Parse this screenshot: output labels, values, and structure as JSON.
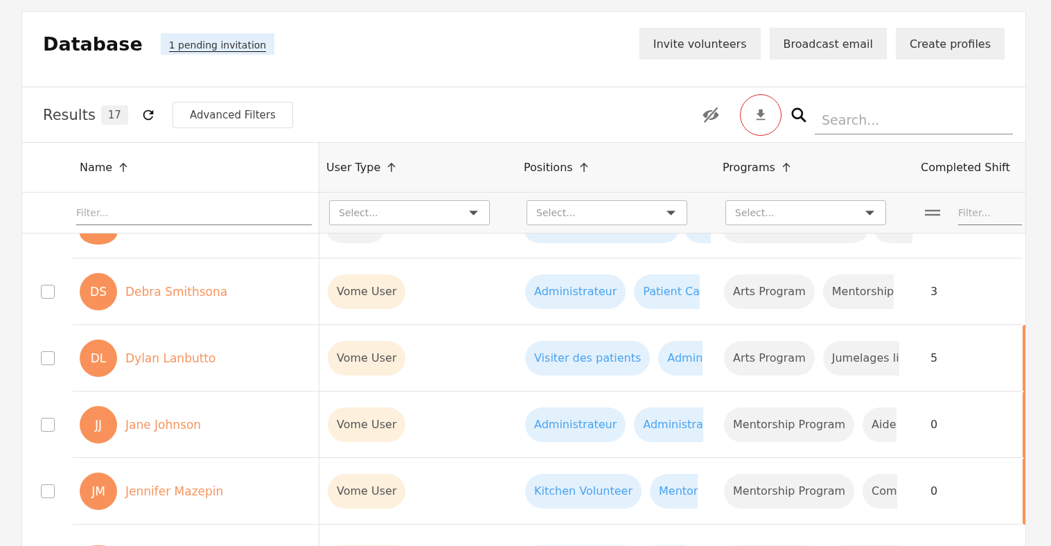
{
  "header": {
    "title": "Database",
    "pending_link": "1 pending invitation",
    "buttons": [
      "Invite volunteers",
      "Broadcast email",
      "Create profiles"
    ]
  },
  "toolbar": {
    "results_label": "Results",
    "results_count": "17",
    "advanced_filters": "Advanced Filters",
    "search_placeholder": "Search..."
  },
  "columns": [
    {
      "label": "Name",
      "sort_icon": true
    },
    {
      "label": "User Type",
      "sort_icon": true
    },
    {
      "label": "Positions",
      "sort_icon": true
    },
    {
      "label": "Programs",
      "sort_icon": true
    },
    {
      "label": "Completed Shift",
      "sort_icon": false
    }
  ],
  "filters": [
    {
      "kind": "text",
      "placeholder": "Filter..."
    },
    {
      "kind": "select",
      "placeholder": "Select..."
    },
    {
      "kind": "select",
      "placeholder": "Select..."
    },
    {
      "kind": "select",
      "placeholder": "Select..."
    },
    {
      "kind": "number",
      "placeholder": "Filter..."
    }
  ],
  "rows": [
    {
      "checked": false,
      "initials": "DS",
      "name": "Debra Smithsona",
      "user_type": "Vome User",
      "positions": [
        "Administrateur",
        "Patient Ca"
      ],
      "programs": [
        "Arts Program",
        "Mentorship"
      ],
      "completed_shifts": "3"
    },
    {
      "checked": false,
      "initials": "DL",
      "name": "Dylan Lanbutto",
      "user_type": "Vome User",
      "positions": [
        "Visiter des patients",
        "Admin"
      ],
      "programs": [
        "Arts Program",
        "Jumelages li"
      ],
      "completed_shifts": "5"
    },
    {
      "checked": false,
      "initials": "JJ",
      "name": "Jane Johnson",
      "user_type": "Vome User",
      "positions": [
        "Administrateur",
        "Administra"
      ],
      "programs": [
        "Mentorship Program",
        "Aide"
      ],
      "completed_shifts": "0"
    },
    {
      "checked": false,
      "initials": "JM",
      "name": "Jennifer Mazepin",
      "user_type": "Vome User",
      "positions": [
        "Kitchen Volunteer",
        "Mentor"
      ],
      "programs": [
        "Mentorship Program",
        "Com"
      ],
      "completed_shifts": "0"
    }
  ]
}
